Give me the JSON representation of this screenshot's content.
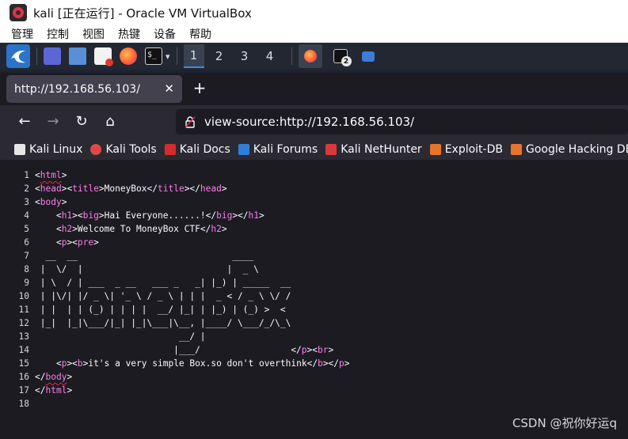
{
  "vbox": {
    "title": "kali [正在运行] - Oracle VM VirtualBox",
    "menu": [
      "管理",
      "控制",
      "视图",
      "热键",
      "设备",
      "帮助"
    ]
  },
  "panel": {
    "workspaces": [
      "1",
      "2",
      "3",
      "4"
    ],
    "terminal_badge": "2"
  },
  "browser": {
    "tab_title": "http://192.168.56.103/",
    "url": "view-source:http://192.168.56.103/",
    "bookmarks": [
      "Kali Linux",
      "Kali Tools",
      "Kali Docs",
      "Kali Forums",
      "Kali NetHunter",
      "Exploit-DB",
      "Google Hacking DB"
    ]
  },
  "source": {
    "line_numbers": [
      "1",
      "2",
      "3",
      "4",
      "5",
      "6",
      "7",
      "8",
      "9",
      "10",
      "11",
      "12",
      "13",
      "14",
      "15",
      "16",
      "17",
      "18"
    ],
    "lines": {
      "l7": "  __  __                             ____",
      "l8": " |  \\/  |                           |  _ \\",
      "l9": " | \\  / | ___  _ __   ___ _   _| |_) | _____  __",
      "l10": " | |\\/| |/ _ \\| '_ \\ / _ \\ | | |  _ < / _ \\ \\/ /",
      "l11": " | |  | | (_) | | | |  __/ |_| | |_) | (_) >  <",
      "l12": " |_|  |_|\\___/|_| |_|\\___|\\__, |____/ \\___/_/\\_\\",
      "l13": "                           __/ |",
      "l14": "                          |___/",
      "l4_text": "Hai Everyone......!",
      "l5_text": "Welcome To MoneyBox CTF",
      "l15_text": "it's a very simple Box.so don't overthink",
      "title_text": "MoneyBox"
    }
  },
  "watermark": "CSDN @祝你好运q"
}
